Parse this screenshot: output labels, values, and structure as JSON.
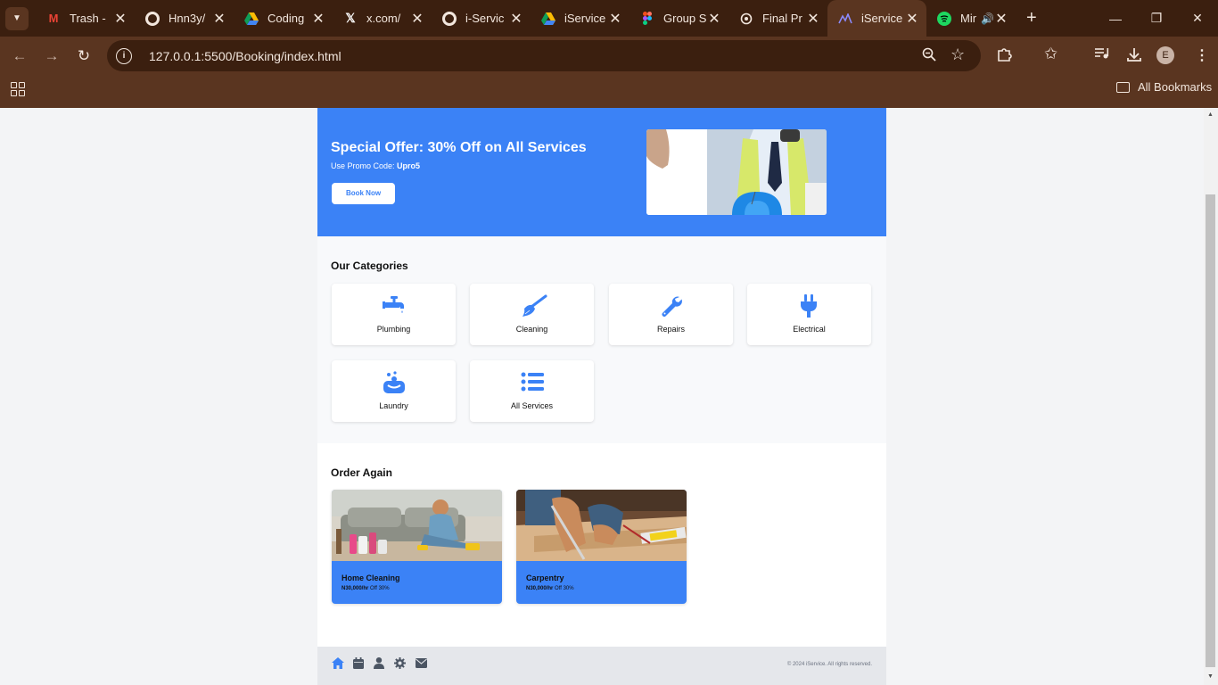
{
  "browser": {
    "tabs": [
      {
        "label": "Trash -",
        "icon": "gmail-icon"
      },
      {
        "label": "Hnn3y/",
        "icon": "github-icon"
      },
      {
        "label": "Coding",
        "icon": "google-drive-icon"
      },
      {
        "label": "x.com/",
        "icon": "x-icon"
      },
      {
        "label": "i-Servic",
        "icon": "github-icon"
      },
      {
        "label": "iService",
        "icon": "google-drive-icon"
      },
      {
        "label": "Group S",
        "icon": "figma-icon"
      },
      {
        "label": "Final Pr",
        "icon": "chatgpt-icon"
      },
      {
        "label": "iService",
        "icon": "iservice-icon",
        "active": true
      },
      {
        "label": "Min",
        "icon": "spotify-icon"
      }
    ],
    "url": "127.0.0.1:5500/Booking/index.html",
    "profile_initial": "E",
    "bookmarks_label": "All Bookmarks"
  },
  "hero": {
    "title": "Special Offer: 30% Off on All Services",
    "promo_prefix": "Use Promo Code: ",
    "promo_code": "Upro5",
    "button": "Book Now"
  },
  "categories": {
    "title": "Our Categories",
    "items": [
      {
        "label": "Plumbing",
        "icon": "faucet-icon"
      },
      {
        "label": "Cleaning",
        "icon": "broom-icon"
      },
      {
        "label": "Repairs",
        "icon": "wrench-icon"
      },
      {
        "label": "Electrical",
        "icon": "plug-icon"
      },
      {
        "label": "Laundry",
        "icon": "soap-icon"
      },
      {
        "label": "All Services",
        "icon": "list-icon"
      }
    ]
  },
  "order_again": {
    "title": "Order Again",
    "items": [
      {
        "title": "Home Cleaning",
        "price": "N30,000/hr",
        "discount": "Off 30%"
      },
      {
        "title": "Carpentry",
        "price": "N30,000/hr",
        "discount": "Off 30%"
      }
    ]
  },
  "footer": {
    "icons": [
      "home-icon",
      "calendar-icon",
      "user-icon",
      "settings-icon",
      "mail-icon"
    ],
    "copyright": "© 2024 iService. All rights reserved."
  },
  "colors": {
    "accent": "#3b82f6",
    "chrome_dark": "#3b1f0f",
    "chrome": "#5a3520"
  }
}
